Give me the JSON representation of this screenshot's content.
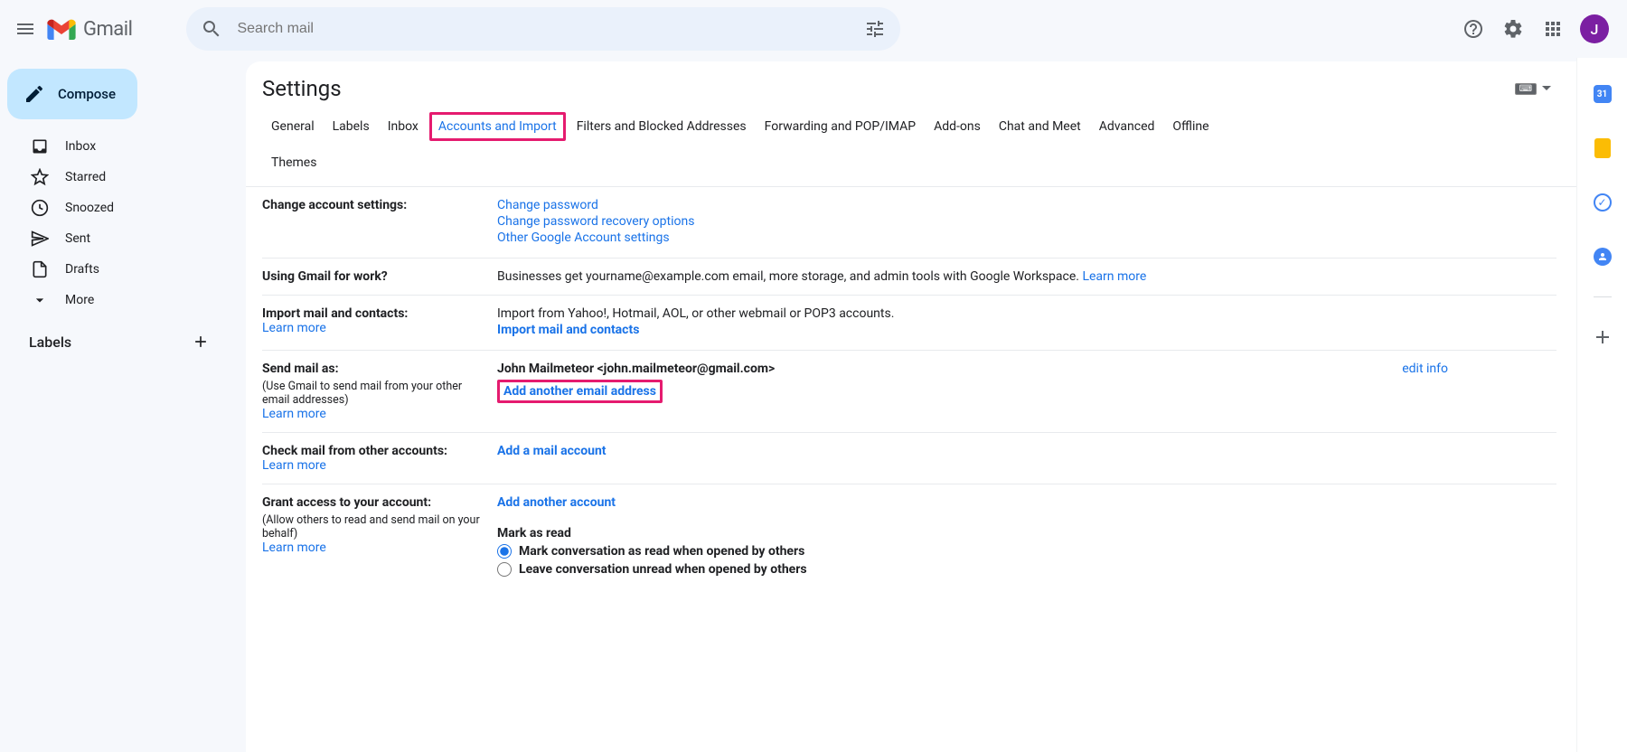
{
  "header": {
    "product": "Gmail",
    "search_placeholder": "Search mail",
    "avatar_initial": "J"
  },
  "sidebar": {
    "compose": "Compose",
    "items": [
      {
        "label": "Inbox"
      },
      {
        "label": "Starred"
      },
      {
        "label": "Snoozed"
      },
      {
        "label": "Sent"
      },
      {
        "label": "Drafts"
      },
      {
        "label": "More"
      }
    ],
    "labels_header": "Labels"
  },
  "settings": {
    "title": "Settings",
    "tabs": [
      "General",
      "Labels",
      "Inbox",
      "Accounts and Import",
      "Filters and Blocked Addresses",
      "Forwarding and POP/IMAP",
      "Add-ons",
      "Chat and Meet",
      "Advanced",
      "Offline"
    ],
    "themes_tab": "Themes",
    "sections": {
      "change_account": {
        "title": "Change account settings:",
        "links": [
          "Change password",
          "Change password recovery options",
          "Other Google Account settings"
        ]
      },
      "work": {
        "title": "Using Gmail for work?",
        "text": "Businesses get yourname@example.com email, more storage, and admin tools with Google Workspace. ",
        "learn": "Learn more"
      },
      "import": {
        "title": "Import mail and contacts:",
        "learn": "Learn more",
        "text": "Import from Yahoo!, Hotmail, AOL, or other webmail or POP3 accounts.",
        "action": "Import mail and contacts"
      },
      "send_as": {
        "title": "Send mail as:",
        "sub": "(Use Gmail to send mail from your other email addresses)",
        "learn": "Learn more",
        "account": "John Mailmeteor <john.mailmeteor@gmail.com>",
        "edit": "edit info",
        "add": "Add another email address"
      },
      "check_mail": {
        "title": "Check mail from other accounts:",
        "learn": "Learn more",
        "action": "Add a mail account"
      },
      "grant": {
        "title": "Grant access to your account:",
        "sub": "(Allow others to read and send mail on your behalf)",
        "learn": "Learn more",
        "action": "Add another account",
        "mark_as_read_title": "Mark as read",
        "opt1": "Mark conversation as read when opened by others",
        "opt2": "Leave conversation unread when opened by others"
      }
    }
  },
  "sidepanel": {
    "calendar_day": "31"
  }
}
